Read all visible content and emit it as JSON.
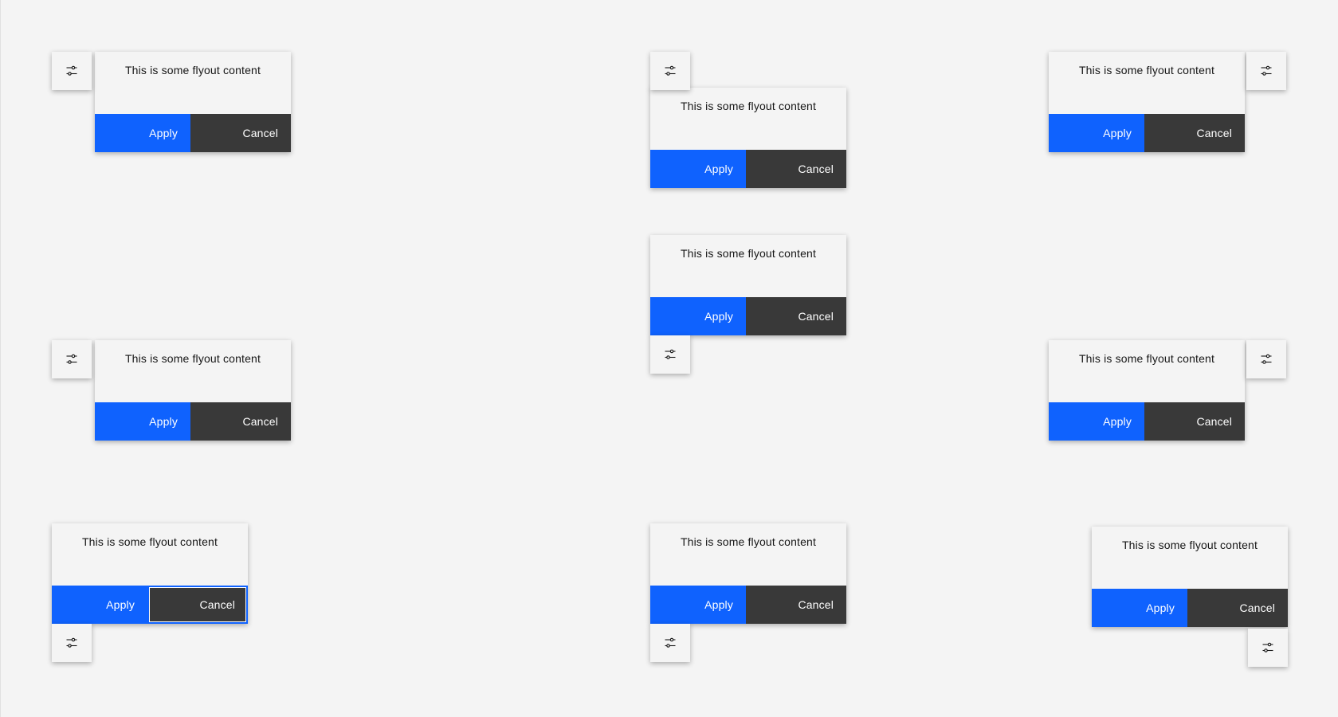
{
  "flyout": {
    "content": "This is some flyout content",
    "apply_label": "Apply",
    "cancel_label": "Cancel",
    "trigger_icon": "settings-adjust-icon",
    "colors": {
      "background": "#f4f4f4",
      "apply": "#0f62fe",
      "cancel": "#393939",
      "text": "#161616",
      "focus": "#0f62fe"
    }
  },
  "examples": [
    {
      "id": "top-left"
    },
    {
      "id": "top-center"
    },
    {
      "id": "top-right"
    },
    {
      "id": "middle-left"
    },
    {
      "id": "middle-center"
    },
    {
      "id": "middle-right"
    },
    {
      "id": "bottom-left"
    },
    {
      "id": "bottom-center"
    },
    {
      "id": "bottom-right"
    }
  ]
}
